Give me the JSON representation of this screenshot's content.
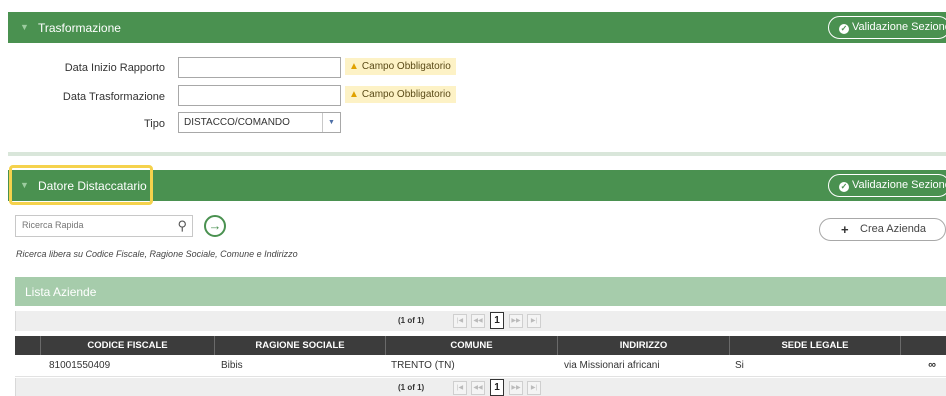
{
  "trasformazione": {
    "title": "Trasformazione",
    "validate_label": "Validazione Sezione",
    "fields": {
      "data_inizio": {
        "label": "Data Inizio Rapporto",
        "value": "",
        "warning": "Campo Obbligatorio"
      },
      "data_trasformazione": {
        "label": "Data Trasformazione",
        "value": "",
        "warning": "Campo Obbligatorio"
      },
      "tipo": {
        "label": "Tipo",
        "value": "DISTACCO/COMANDO"
      }
    }
  },
  "datore": {
    "title": "Datore Distaccatario",
    "validate_label": "Validazione Sezione",
    "search": {
      "placeholder": "Ricerca Rapida"
    },
    "hint": "Ricerca libera su Codice Fiscale, Ragione Sociale, Comune e Indirizzo",
    "crea_label": "Crea Azienda"
  },
  "lista": {
    "title": "Lista Aziende",
    "pager": {
      "count": "(1 of 1)",
      "page": "1"
    },
    "columns": [
      "CODICE FISCALE",
      "RAGIONE SOCIALE",
      "COMUNE",
      "INDIRIZZO",
      "SEDE LEGALE"
    ],
    "rows": [
      {
        "codice_fiscale": "81001550409",
        "ragione_sociale": "Bibis",
        "comune": "TRENTO (TN)",
        "indirizzo": "via Missionari africani",
        "sede_legale": "Si"
      }
    ]
  },
  "colors": {
    "header_green": "#4a9150",
    "list_header_green": "#a6ccab",
    "highlight": "#f5d24c",
    "warning_bg": "#fdf2c6",
    "table_header": "#3c3c3c"
  },
  "icons": {
    "toggle": "triangle-down-icon",
    "validate": "check-circle-icon",
    "warning": "warning-triangle-icon",
    "search": "search-icon",
    "go": "arrow-right-circle-icon",
    "add": "plus-icon",
    "link": "link-icon"
  }
}
